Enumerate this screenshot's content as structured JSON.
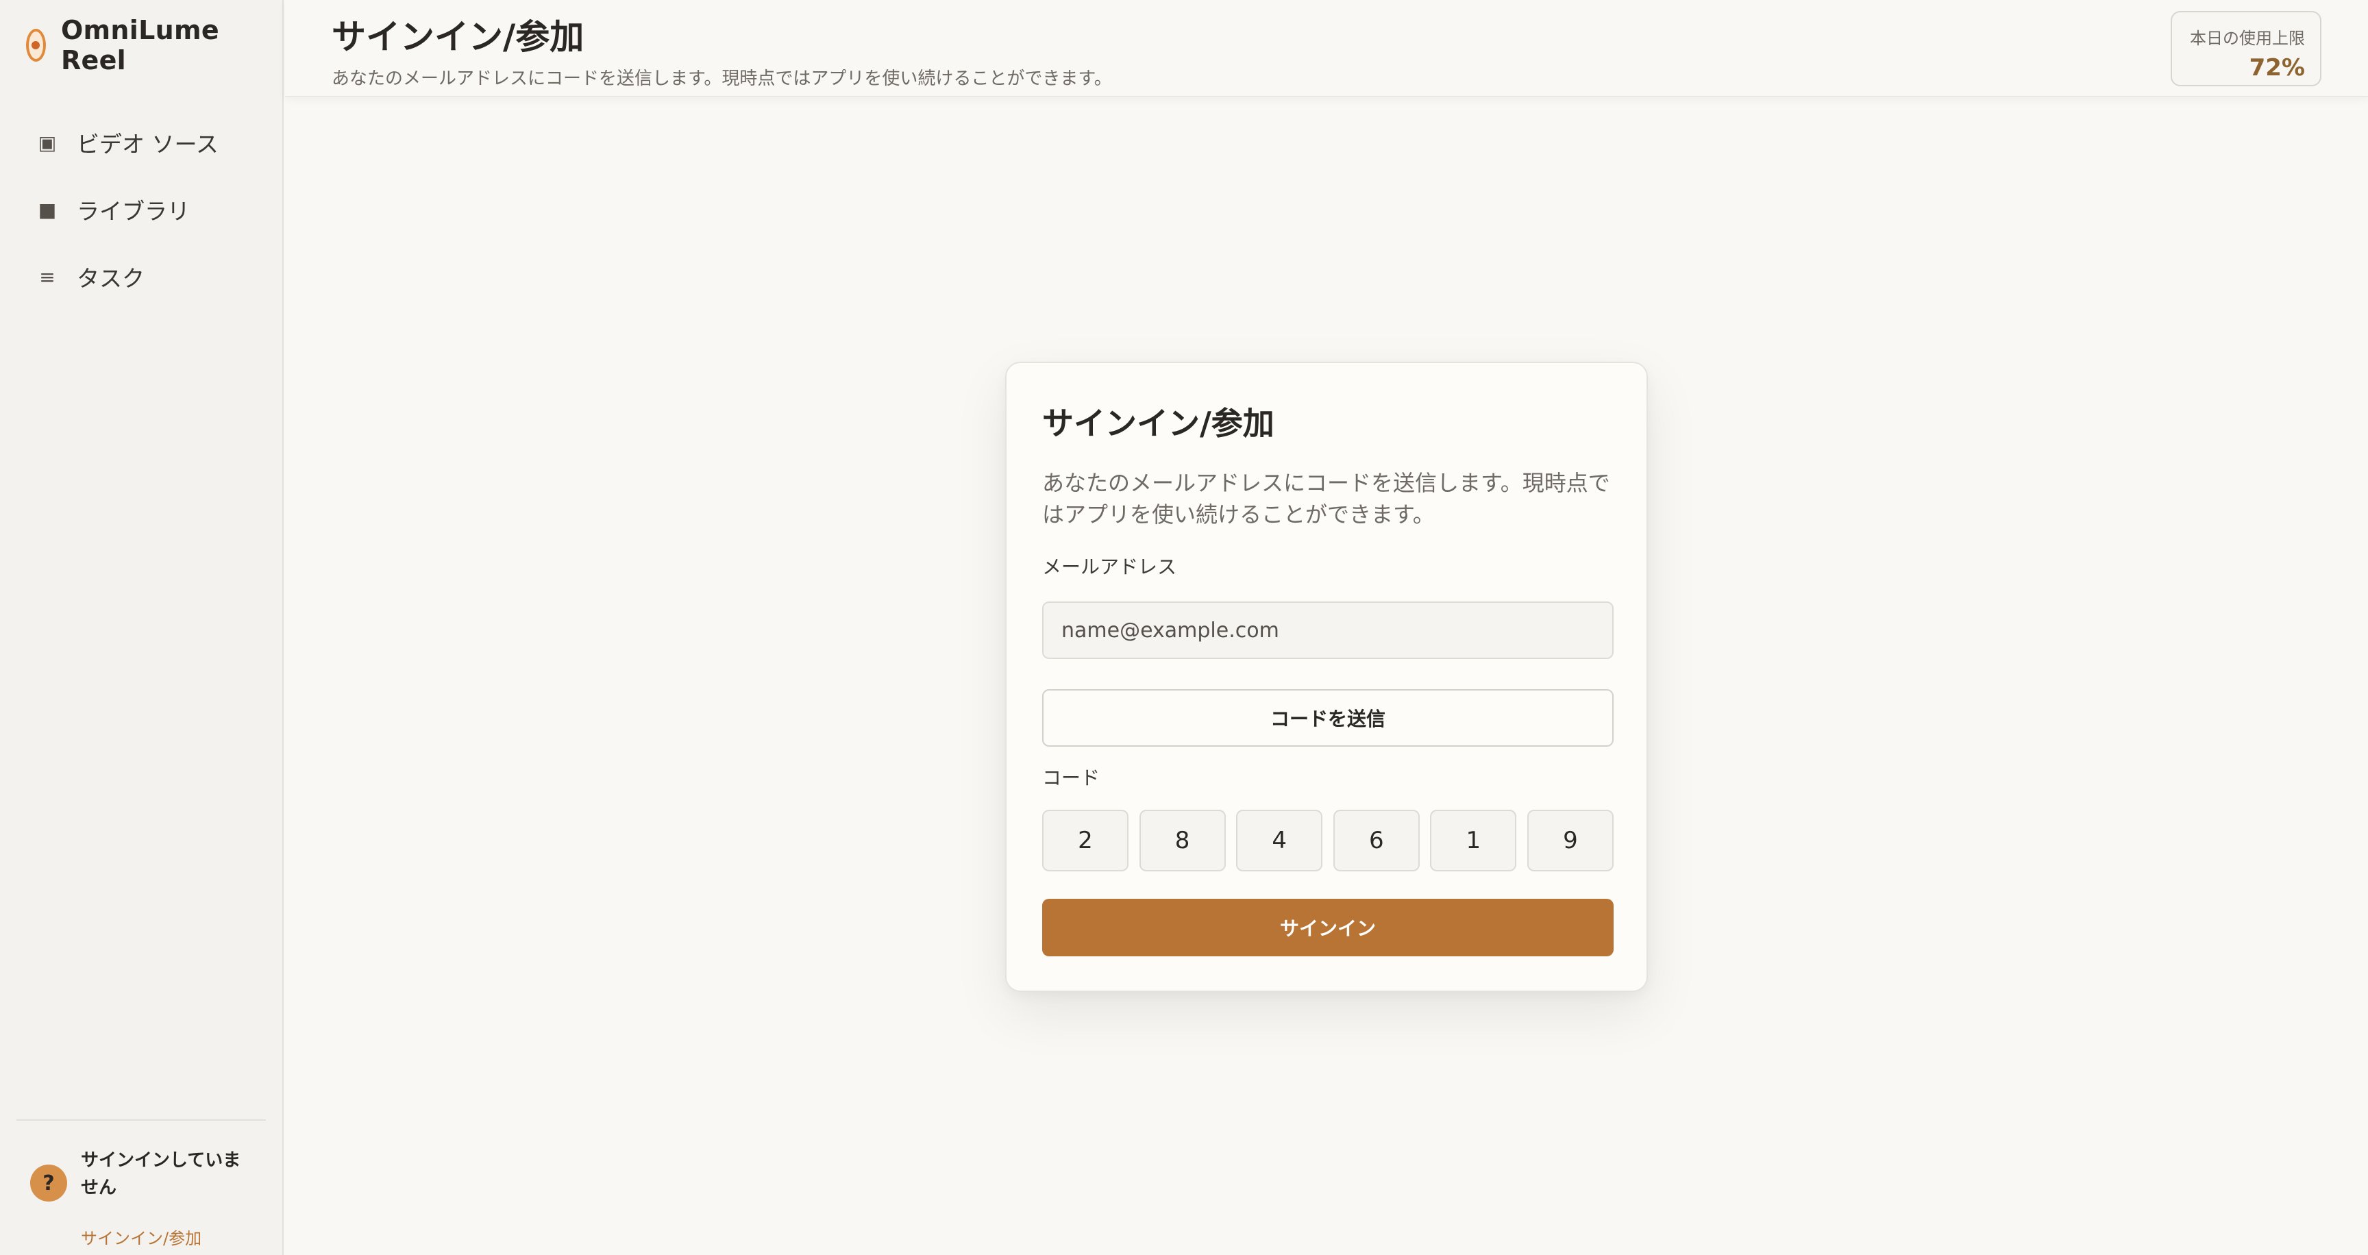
{
  "app": {
    "name": "OmniLume Reel"
  },
  "sidebar": {
    "items": [
      {
        "label": "ビデオ ソース",
        "icon": "video-source-icon",
        "glyph": "▣"
      },
      {
        "label": "ライブラリ",
        "icon": "library-icon",
        "glyph": "■"
      },
      {
        "label": "タスク",
        "icon": "tasks-icon",
        "glyph": "≡"
      }
    ],
    "account": {
      "avatar": "?",
      "status": "サインインしていません",
      "link": "サインイン/参加"
    }
  },
  "header": {
    "title": "サインイン/参加",
    "subtitle": "あなたのメールアドレスにコードを送信します。現時点ではアプリを使い続けることができます。",
    "usage": {
      "label": "本日の使用上限",
      "value": "72%"
    }
  },
  "card": {
    "title": "サインイン/参加",
    "description": "あなたのメールアドレスにコードを送信します。現時点ではアプリを使い続けることができます。",
    "email": {
      "label": "メールアドレス",
      "placeholder": "name@example.com",
      "value": ""
    },
    "send_button": "コードを送信",
    "code": {
      "label": "コード",
      "digits": [
        "2",
        "8",
        "4",
        "6",
        "1",
        "9"
      ]
    },
    "signin_button": "サインイン"
  },
  "colors": {
    "accent": "#b87435",
    "usage_value": "#8d6330",
    "avatar": "#d7904a"
  }
}
